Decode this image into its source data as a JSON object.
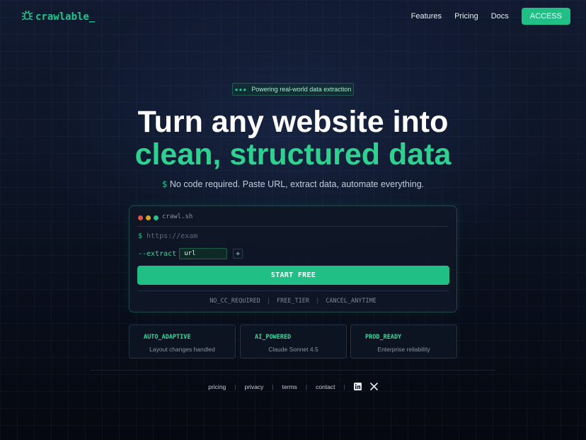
{
  "brand": {
    "name": "crawlable_"
  },
  "nav": {
    "links": [
      "Features",
      "Pricing",
      "Docs"
    ],
    "cta": "ACCESS"
  },
  "hero": {
    "badge": "Powering real-world data extraction",
    "title_line1": "Turn any website into",
    "title_line2": "clean, structured data",
    "subtitle_prompt": "$",
    "subtitle": "No code required. Paste URL, extract data, automate everything."
  },
  "terminal": {
    "title": "crawl.sh",
    "prompt": "$",
    "url_placeholder": "https://exam",
    "extract_label": "--extract",
    "extract_value": "url",
    "add_label": "+",
    "start_button": "START FREE",
    "perks": [
      "NO_CC_REQUIRED",
      "FREE_TIER",
      "CANCEL_ANYTIME"
    ]
  },
  "features": [
    {
      "title": "AUTO_ADAPTIVE",
      "desc": "Layout changes handled"
    },
    {
      "title": "AI_POWERED",
      "desc": "Claude Sonnet 4.5"
    },
    {
      "title": "PROD_READY",
      "desc": "Enterprise reliability"
    }
  ],
  "footer": {
    "links": [
      "pricing",
      "privacy",
      "terms",
      "contact"
    ],
    "social": [
      "linkedin-icon",
      "x-icon"
    ]
  },
  "colors": {
    "accent": "#1fbf86",
    "accent_text": "#2fd191",
    "background": "#0b1120",
    "dot_red": "#e5534b",
    "dot_yellow": "#d9a22b",
    "dot_green": "#22c58b"
  }
}
